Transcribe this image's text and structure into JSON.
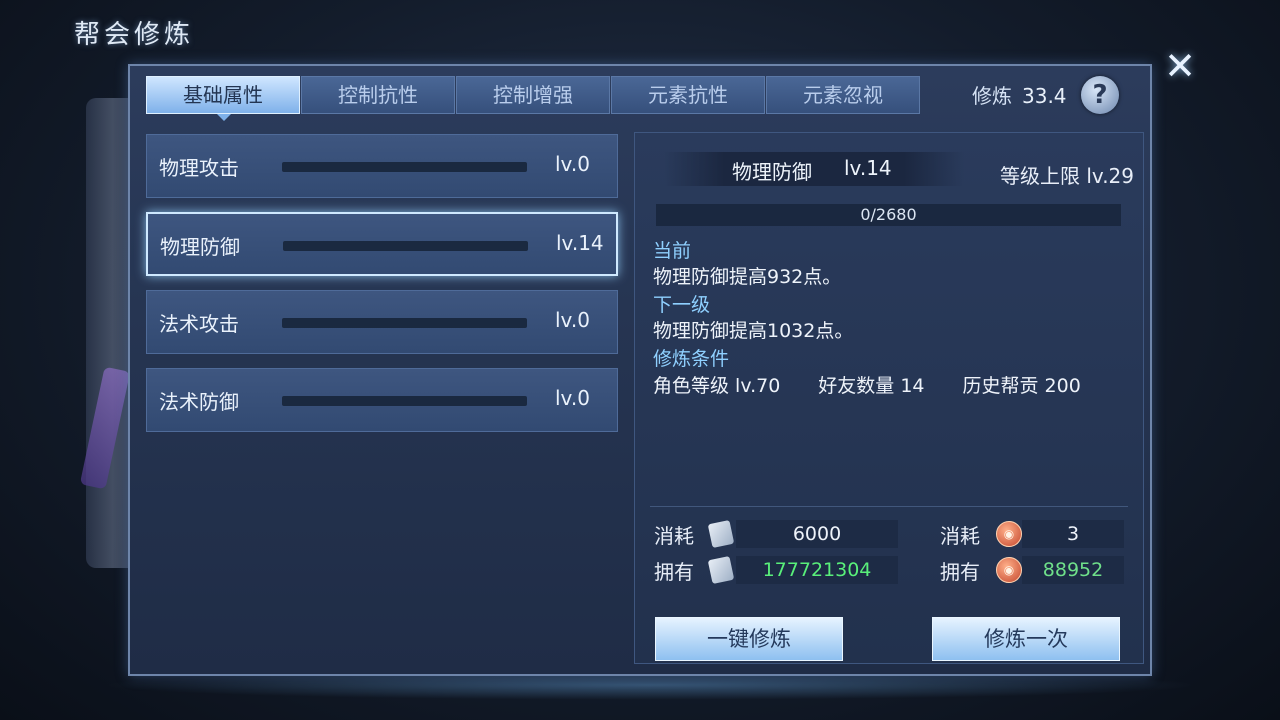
{
  "window": {
    "title": "帮会修炼"
  },
  "tabs": [
    {
      "label": "基础属性",
      "active": true
    },
    {
      "label": "控制抗性",
      "active": false
    },
    {
      "label": "控制增强",
      "active": false
    },
    {
      "label": "元素抗性",
      "active": false
    },
    {
      "label": "元素忽视",
      "active": false
    }
  ],
  "cultivate": {
    "label": "修炼",
    "value": "33.4"
  },
  "stats": [
    {
      "name": "物理攻击",
      "level": "lv.0",
      "progress": 0
    },
    {
      "name": "物理防御",
      "level": "lv.14",
      "progress": 0
    },
    {
      "name": "法术攻击",
      "level": "lv.0",
      "progress": 0
    },
    {
      "name": "法术防御",
      "level": "lv.0",
      "progress": 0
    }
  ],
  "detail": {
    "name": "物理防御",
    "level": "lv.14",
    "cap": "等级上限 lv.29",
    "progress_text": "0/2680",
    "progress": 0,
    "current_label": "当前",
    "current_text": "物理防御提高932点。",
    "next_label": "下一级",
    "next_text": "物理防御提高1032点。",
    "cond_label": "修炼条件",
    "cond_text": "角色等级 lv.70　　好友数量 14　　历史帮贡 200"
  },
  "costs": {
    "left": {
      "consume_label": "消耗",
      "consume_value": "6000",
      "own_label": "拥有",
      "own_value": "177721304",
      "icon": "scroll-icon"
    },
    "right": {
      "consume_label": "消耗",
      "consume_value": "3",
      "own_label": "拥有",
      "own_value": "88952",
      "icon": "coin-icon"
    }
  },
  "buttons": {
    "one_click": "一键修炼",
    "once": "修炼一次"
  },
  "colors": {
    "accent": "#7fb1ea",
    "green": "#59f07a",
    "label_blue": "#8fd0ff"
  }
}
